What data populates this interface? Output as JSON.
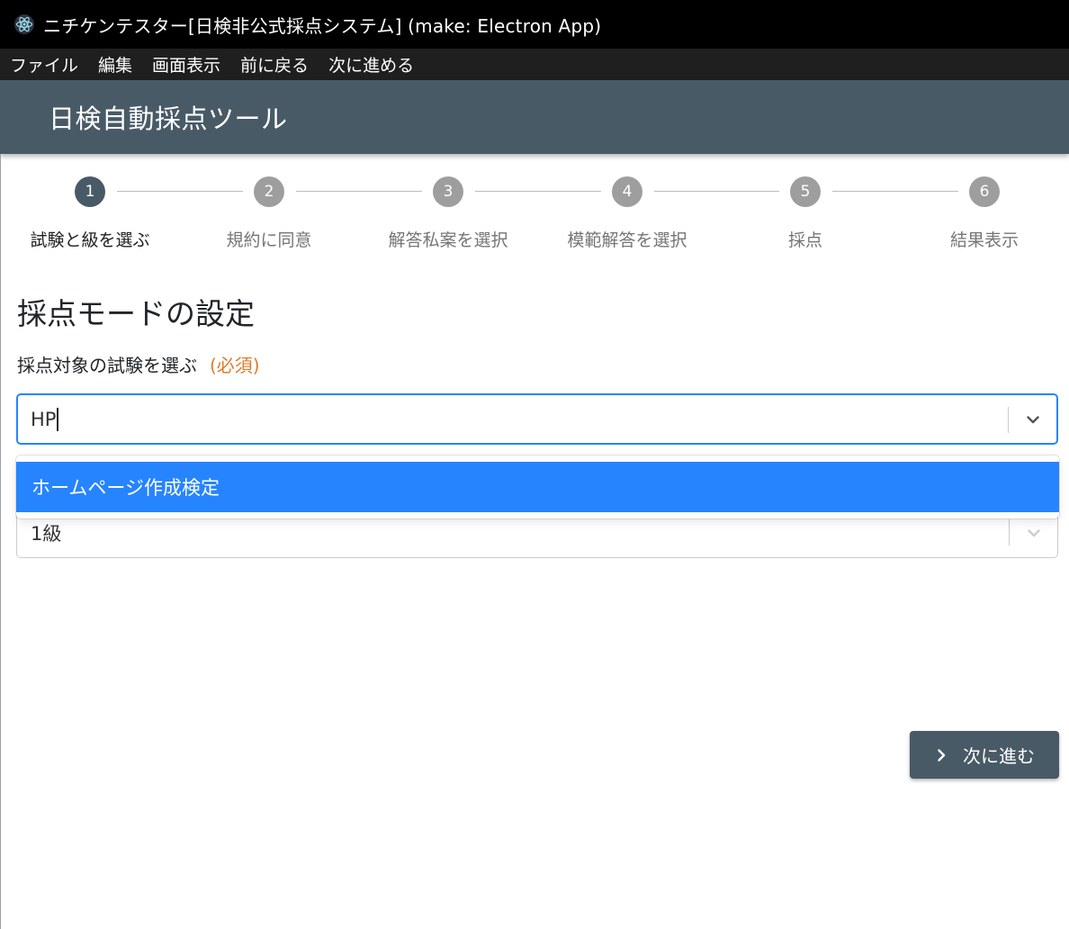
{
  "window": {
    "title": "ニチケンテスター[日検非公式採点システム] (make: Electron App)",
    "icon": "electron-icon"
  },
  "menu": {
    "items": [
      "ファイル",
      "編集",
      "画面表示",
      "前に戻る",
      "次に進める"
    ]
  },
  "appbar": {
    "title": "日検自動採点ツール"
  },
  "stepper": {
    "active_step": 1,
    "steps": [
      {
        "number": "1",
        "label": "試験と級を選ぶ"
      },
      {
        "number": "2",
        "label": "規約に同意"
      },
      {
        "number": "3",
        "label": "解答私案を選択"
      },
      {
        "number": "4",
        "label": "模範解答を選択"
      },
      {
        "number": "5",
        "label": "採点"
      },
      {
        "number": "6",
        "label": "結果表示"
      }
    ]
  },
  "form": {
    "section_title": "採点モードの設定",
    "exam_label": "採点対象の試験を選ぶ",
    "required_label": "(必須)",
    "exam_input_value": "HP",
    "exam_options": [
      "ホームページ作成検定"
    ],
    "grade_value": "1級"
  },
  "actions": {
    "next_label": "次に進む"
  },
  "colors": {
    "primary": "#485a66",
    "focus": "#2684ff",
    "required": "#e07b28",
    "inactive_step": "#9e9e9e"
  }
}
